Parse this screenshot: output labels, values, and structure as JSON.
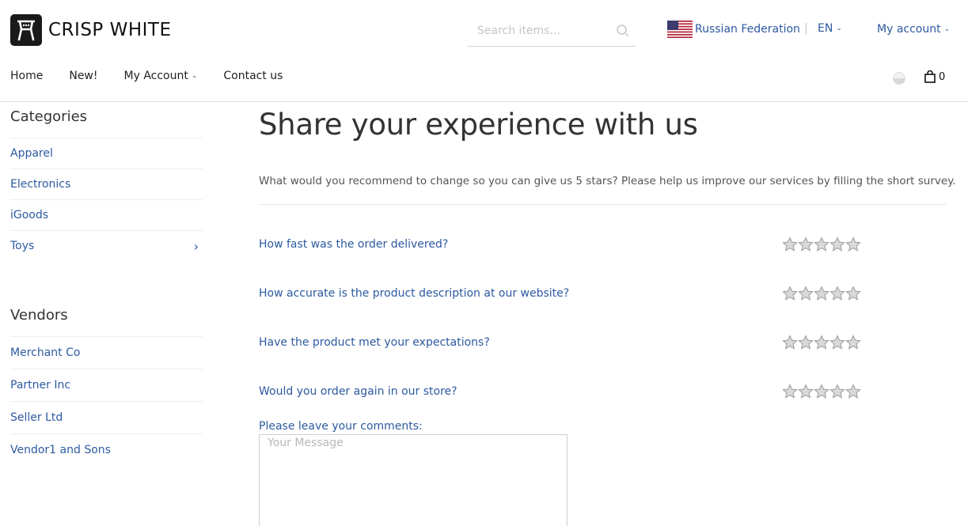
{
  "brand": {
    "name": "CRISP WHITE",
    "logo_icon": "store-logo-icon"
  },
  "search": {
    "placeholder": "Search items..."
  },
  "topbar": {
    "country": "Russian Federation",
    "separator": "|",
    "language": "EN",
    "account": "My account"
  },
  "nav": {
    "items": [
      {
        "label": "Home"
      },
      {
        "label": "New!"
      },
      {
        "label": "My Account"
      },
      {
        "label": "Contact us"
      }
    ]
  },
  "cart": {
    "count": "0"
  },
  "sidebar": {
    "categories_heading": "Categories",
    "categories": [
      {
        "label": "Apparel"
      },
      {
        "label": "Electronics"
      },
      {
        "label": "iGoods"
      },
      {
        "label": "Toys"
      }
    ],
    "vendors_heading": "Vendors",
    "vendors": [
      {
        "label": "Merchant Co"
      },
      {
        "label": "Partner Inc"
      },
      {
        "label": "Seller Ltd"
      },
      {
        "label": "Vendor1 and Sons"
      }
    ]
  },
  "main": {
    "title": "Share your experience with us",
    "intro": "What would you recommend to change so you can give us 5 stars? Please help us improve our services by filling the short survey.",
    "questions": [
      {
        "label": "How fast was the order delivered?",
        "rating": 0,
        "max": 5
      },
      {
        "label": "How accurate is the product description at our website?",
        "rating": 0,
        "max": 5
      },
      {
        "label": "Have the product met your expectations?",
        "rating": 0,
        "max": 5
      },
      {
        "label": "Would you order again in our store?",
        "rating": 0,
        "max": 5
      }
    ],
    "comment_label": "Please leave your comments:",
    "comment_placeholder": "Your Message"
  },
  "colors": {
    "link": "#2d5aa0",
    "text": "#333333",
    "border": "#dcdcdc"
  }
}
